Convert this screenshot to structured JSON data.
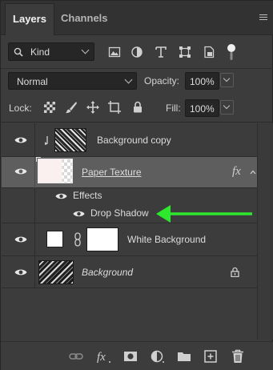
{
  "tabs": [
    {
      "label": "Layers",
      "active": true
    },
    {
      "label": "Channels",
      "active": false
    }
  ],
  "filter": {
    "kind_value": "Kind",
    "filter_icons": [
      "image-filter-icon",
      "adjustment-filter-icon",
      "type-filter-icon",
      "shape-filter-icon",
      "smart-object-filter-icon",
      "filter-toggle-icon"
    ]
  },
  "blend": {
    "mode_value": "Normal",
    "opacity_label": "Opacity:",
    "opacity_value": "100%"
  },
  "lock": {
    "label": "Lock:",
    "fill_label": "Fill:",
    "fill_value": "100%"
  },
  "layers": [
    {
      "name": "Background copy",
      "clipped": true
    },
    {
      "name": "Paper Texture",
      "fx": "fx",
      "selected": true
    },
    {
      "name": "Effects"
    },
    {
      "name": "Drop Shadow"
    },
    {
      "name": "White Background"
    },
    {
      "name": "Background",
      "locked": true
    }
  ],
  "colors": {
    "panel": "#3c3c3c",
    "selected_row": "#5e5e5e",
    "arrow": "#2ee82e"
  },
  "bottom_icons": [
    "link-layers-icon",
    "fx-icon",
    "add-mask-icon",
    "adjustment-layer-icon",
    "new-group-icon",
    "new-layer-icon",
    "delete-icon"
  ]
}
